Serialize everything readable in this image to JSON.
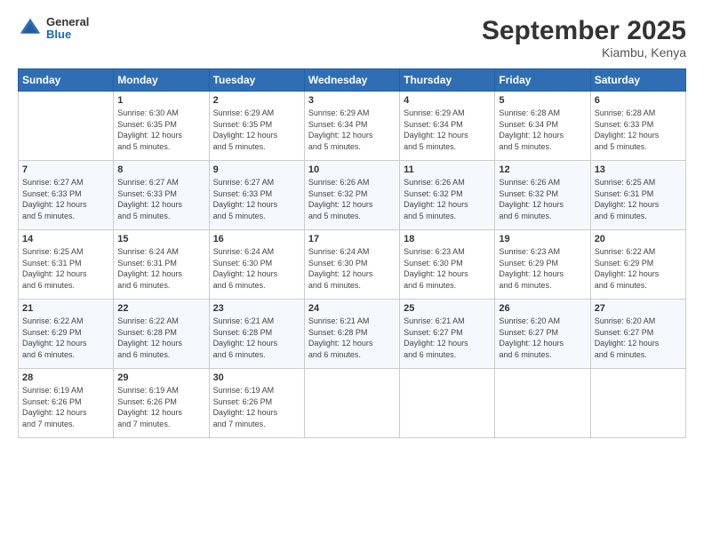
{
  "header": {
    "logo_general": "General",
    "logo_blue": "Blue",
    "month_title": "September 2025",
    "location": "Kiambu, Kenya"
  },
  "days_of_week": [
    "Sunday",
    "Monday",
    "Tuesday",
    "Wednesday",
    "Thursday",
    "Friday",
    "Saturday"
  ],
  "weeks": [
    [
      {
        "num": "",
        "info": ""
      },
      {
        "num": "1",
        "info": "Sunrise: 6:30 AM\nSunset: 6:35 PM\nDaylight: 12 hours\nand 5 minutes."
      },
      {
        "num": "2",
        "info": "Sunrise: 6:29 AM\nSunset: 6:35 PM\nDaylight: 12 hours\nand 5 minutes."
      },
      {
        "num": "3",
        "info": "Sunrise: 6:29 AM\nSunset: 6:34 PM\nDaylight: 12 hours\nand 5 minutes."
      },
      {
        "num": "4",
        "info": "Sunrise: 6:29 AM\nSunset: 6:34 PM\nDaylight: 12 hours\nand 5 minutes."
      },
      {
        "num": "5",
        "info": "Sunrise: 6:28 AM\nSunset: 6:34 PM\nDaylight: 12 hours\nand 5 minutes."
      },
      {
        "num": "6",
        "info": "Sunrise: 6:28 AM\nSunset: 6:33 PM\nDaylight: 12 hours\nand 5 minutes."
      }
    ],
    [
      {
        "num": "7",
        "info": "Sunrise: 6:27 AM\nSunset: 6:33 PM\nDaylight: 12 hours\nand 5 minutes."
      },
      {
        "num": "8",
        "info": "Sunrise: 6:27 AM\nSunset: 6:33 PM\nDaylight: 12 hours\nand 5 minutes."
      },
      {
        "num": "9",
        "info": "Sunrise: 6:27 AM\nSunset: 6:33 PM\nDaylight: 12 hours\nand 5 minutes."
      },
      {
        "num": "10",
        "info": "Sunrise: 6:26 AM\nSunset: 6:32 PM\nDaylight: 12 hours\nand 5 minutes."
      },
      {
        "num": "11",
        "info": "Sunrise: 6:26 AM\nSunset: 6:32 PM\nDaylight: 12 hours\nand 5 minutes."
      },
      {
        "num": "12",
        "info": "Sunrise: 6:26 AM\nSunset: 6:32 PM\nDaylight: 12 hours\nand 6 minutes."
      },
      {
        "num": "13",
        "info": "Sunrise: 6:25 AM\nSunset: 6:31 PM\nDaylight: 12 hours\nand 6 minutes."
      }
    ],
    [
      {
        "num": "14",
        "info": "Sunrise: 6:25 AM\nSunset: 6:31 PM\nDaylight: 12 hours\nand 6 minutes."
      },
      {
        "num": "15",
        "info": "Sunrise: 6:24 AM\nSunset: 6:31 PM\nDaylight: 12 hours\nand 6 minutes."
      },
      {
        "num": "16",
        "info": "Sunrise: 6:24 AM\nSunset: 6:30 PM\nDaylight: 12 hours\nand 6 minutes."
      },
      {
        "num": "17",
        "info": "Sunrise: 6:24 AM\nSunset: 6:30 PM\nDaylight: 12 hours\nand 6 minutes."
      },
      {
        "num": "18",
        "info": "Sunrise: 6:23 AM\nSunset: 6:30 PM\nDaylight: 12 hours\nand 6 minutes."
      },
      {
        "num": "19",
        "info": "Sunrise: 6:23 AM\nSunset: 6:29 PM\nDaylight: 12 hours\nand 6 minutes."
      },
      {
        "num": "20",
        "info": "Sunrise: 6:22 AM\nSunset: 6:29 PM\nDaylight: 12 hours\nand 6 minutes."
      }
    ],
    [
      {
        "num": "21",
        "info": "Sunrise: 6:22 AM\nSunset: 6:29 PM\nDaylight: 12 hours\nand 6 minutes."
      },
      {
        "num": "22",
        "info": "Sunrise: 6:22 AM\nSunset: 6:28 PM\nDaylight: 12 hours\nand 6 minutes."
      },
      {
        "num": "23",
        "info": "Sunrise: 6:21 AM\nSunset: 6:28 PM\nDaylight: 12 hours\nand 6 minutes."
      },
      {
        "num": "24",
        "info": "Sunrise: 6:21 AM\nSunset: 6:28 PM\nDaylight: 12 hours\nand 6 minutes."
      },
      {
        "num": "25",
        "info": "Sunrise: 6:21 AM\nSunset: 6:27 PM\nDaylight: 12 hours\nand 6 minutes."
      },
      {
        "num": "26",
        "info": "Sunrise: 6:20 AM\nSunset: 6:27 PM\nDaylight: 12 hours\nand 6 minutes."
      },
      {
        "num": "27",
        "info": "Sunrise: 6:20 AM\nSunset: 6:27 PM\nDaylight: 12 hours\nand 6 minutes."
      }
    ],
    [
      {
        "num": "28",
        "info": "Sunrise: 6:19 AM\nSunset: 6:26 PM\nDaylight: 12 hours\nand 7 minutes."
      },
      {
        "num": "29",
        "info": "Sunrise: 6:19 AM\nSunset: 6:26 PM\nDaylight: 12 hours\nand 7 minutes."
      },
      {
        "num": "30",
        "info": "Sunrise: 6:19 AM\nSunset: 6:26 PM\nDaylight: 12 hours\nand 7 minutes."
      },
      {
        "num": "",
        "info": ""
      },
      {
        "num": "",
        "info": ""
      },
      {
        "num": "",
        "info": ""
      },
      {
        "num": "",
        "info": ""
      }
    ]
  ]
}
